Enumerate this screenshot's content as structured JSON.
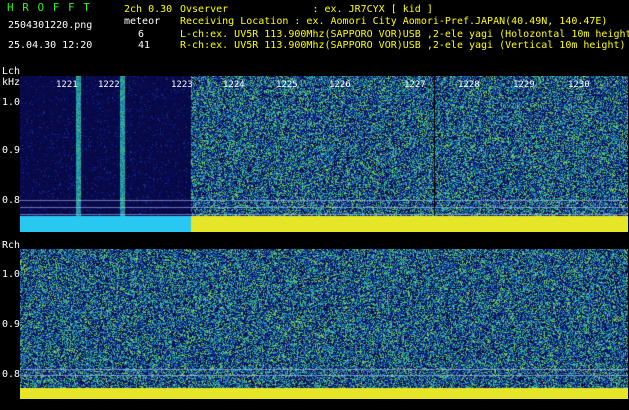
{
  "app": {
    "title": "H R O F F T",
    "filename": "2504301220.png",
    "datetime": "25.04.30 12:20",
    "mode": "2ch 0.30",
    "meteor_label": "meteor",
    "meteor_counts": [
      "6",
      "41"
    ]
  },
  "info": {
    "observer": "Ovserver              : ex. JR7CYX [ kid ]",
    "location": "Receiving Location : ex. Aomori City Aomori-Pref.JAPAN(40.49N, 140.47E)",
    "lch": "L-ch:ex. UV5R 113.900Mhz(SAPPORO VOR)USB ,2-ele yagi (Holozontal 10m height)",
    "rch": "R-ch:ex. UV5R 113.900Mhz(SAPPORO VOR)USB ,2-ele yagi (Vertical 10m height)"
  },
  "panels": {
    "lch_label": "Lch",
    "khz_label": "kHz",
    "rch_label": "Rch",
    "y_ticks_l": [
      "1.0",
      "0.9",
      "0.8"
    ],
    "y_ticks_r": [
      "1.0",
      "0.9",
      "0.8"
    ],
    "time_ticks": [
      "1221",
      "1222",
      "1223",
      "1224",
      "1225",
      "1226",
      "1227",
      "1228",
      "1229",
      "1230"
    ]
  },
  "colors": {
    "background": "#000000",
    "label_green": "#2ef01d",
    "label_yellow": "#ffff00",
    "noise_band": "#ffff00",
    "meteor_cyan": "#35d6ff",
    "waterfall_dark": "#0a0a5a",
    "waterfall_bright": "#1ec8c8"
  }
}
